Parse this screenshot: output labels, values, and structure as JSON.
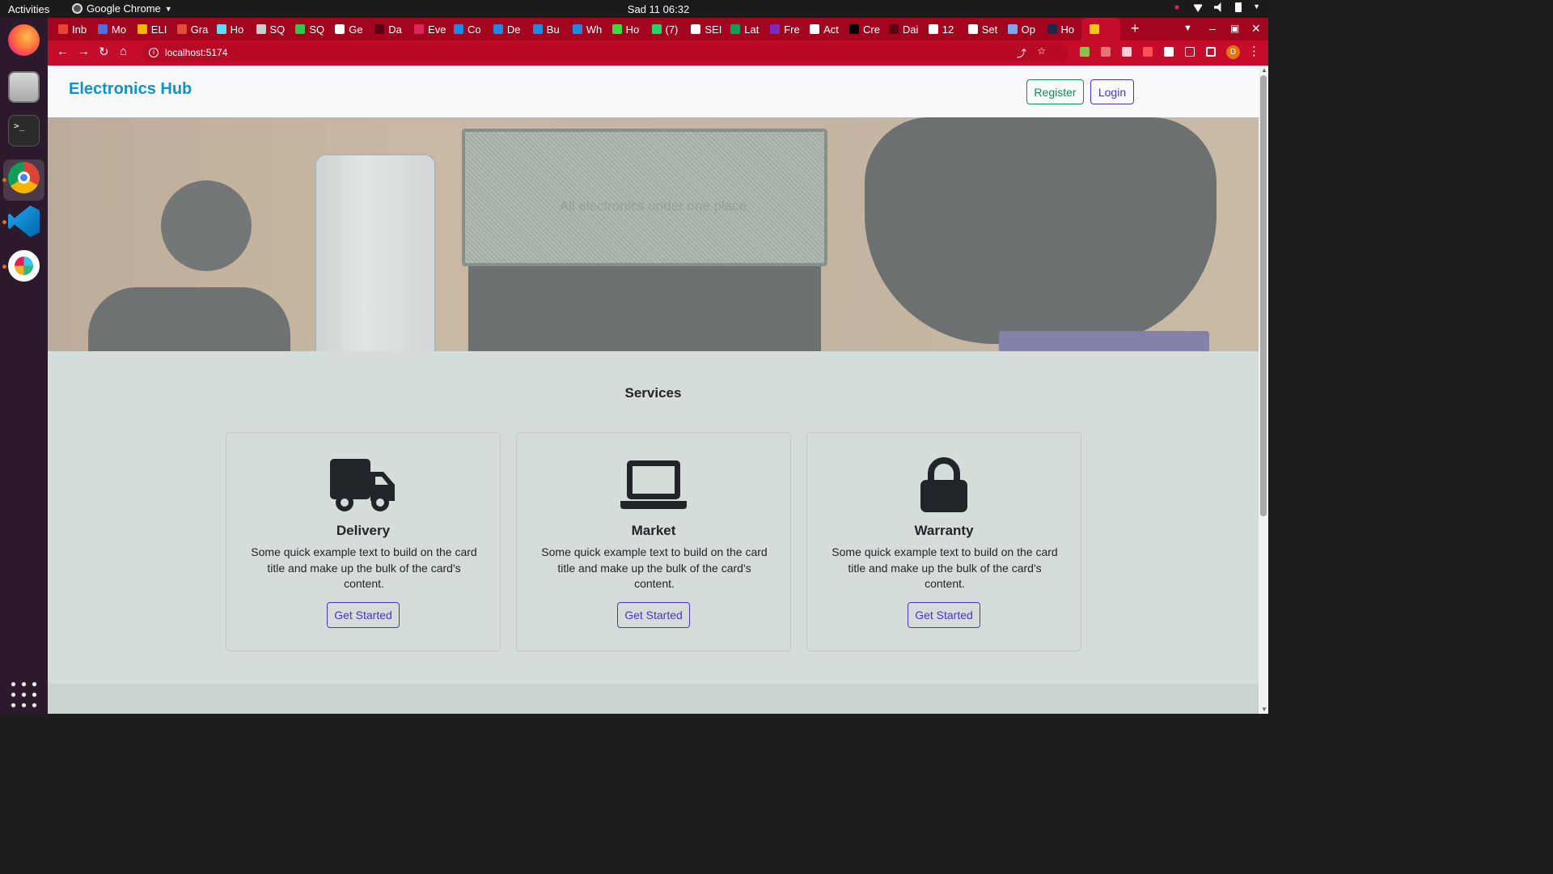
{
  "os": {
    "activities": "Activities",
    "app_name": "Google Chrome",
    "clock": "Sad 11  06:32"
  },
  "browser": {
    "tabs": [
      {
        "label": "Inb",
        "color": "#ea4335"
      },
      {
        "label": "Mo",
        "color": "#4a6fe0"
      },
      {
        "label": "ELI",
        "color": "#f4b400"
      },
      {
        "label": "Gra",
        "color": "#e24c3a"
      },
      {
        "label": "Ho",
        "color": "#61dafb"
      },
      {
        "label": "SQ",
        "color": "#cccccc"
      },
      {
        "label": "SQ",
        "color": "#2fc74a"
      },
      {
        "label": "Ge",
        "color": "#ffffff"
      },
      {
        "label": "Da",
        "color": "#5a0010"
      },
      {
        "label": "Eve",
        "color": "#e0245e"
      },
      {
        "label": "Co",
        "color": "#1e88e5"
      },
      {
        "label": "De",
        "color": "#1e88e5"
      },
      {
        "label": "Bu",
        "color": "#1e88e5"
      },
      {
        "label": "Wh",
        "color": "#1e88e5"
      },
      {
        "label": "Ho",
        "color": "#3ddc3d"
      },
      {
        "label": "(7)",
        "color": "#25d366"
      },
      {
        "label": "SEI",
        "color": "#ffffff"
      },
      {
        "label": "Lat",
        "color": "#0f9d58"
      },
      {
        "label": "Fre",
        "color": "#7b2cbf"
      },
      {
        "label": "Act",
        "color": "#ffffff"
      },
      {
        "label": "Cre",
        "color": "#000000"
      },
      {
        "label": "Dai",
        "color": "#5a0010"
      },
      {
        "label": "12",
        "color": "#ffffff"
      },
      {
        "label": "Set",
        "color": "#ffffff"
      },
      {
        "label": "Op",
        "color": "#7aa6f0"
      },
      {
        "label": "Ho",
        "color": "#1b2a4a"
      },
      {
        "label": "",
        "color": "#f5c518"
      }
    ],
    "url": "localhost:5174",
    "profile_initial": "D"
  },
  "app": {
    "brand": "Electronics Hub",
    "register_label": "Register",
    "login_label": "Login",
    "hero_caption": "All electronics under one place",
    "services_title": "Services",
    "cards": [
      {
        "icon": "truck-icon",
        "title": "Delivery",
        "text": "Some quick example text to build on the card title and make up the bulk of the card's content.",
        "cta": "Get Started"
      },
      {
        "icon": "laptop-icon",
        "title": "Market",
        "text": "Some quick example text to build on the card title and make up the bulk of the card's content.",
        "cta": "Get Started"
      },
      {
        "icon": "lock-icon",
        "title": "Warranty",
        "text": "Some quick example text to build on the card title and make up the bulk of the card's content.",
        "cta": "Get Started"
      }
    ],
    "colors": {
      "brand": "#0f93c8",
      "register": "#198754",
      "primary_outline": "#4936c4",
      "page_bg": "#d4ddd9",
      "chrome_frame": "#c50c2b"
    }
  }
}
